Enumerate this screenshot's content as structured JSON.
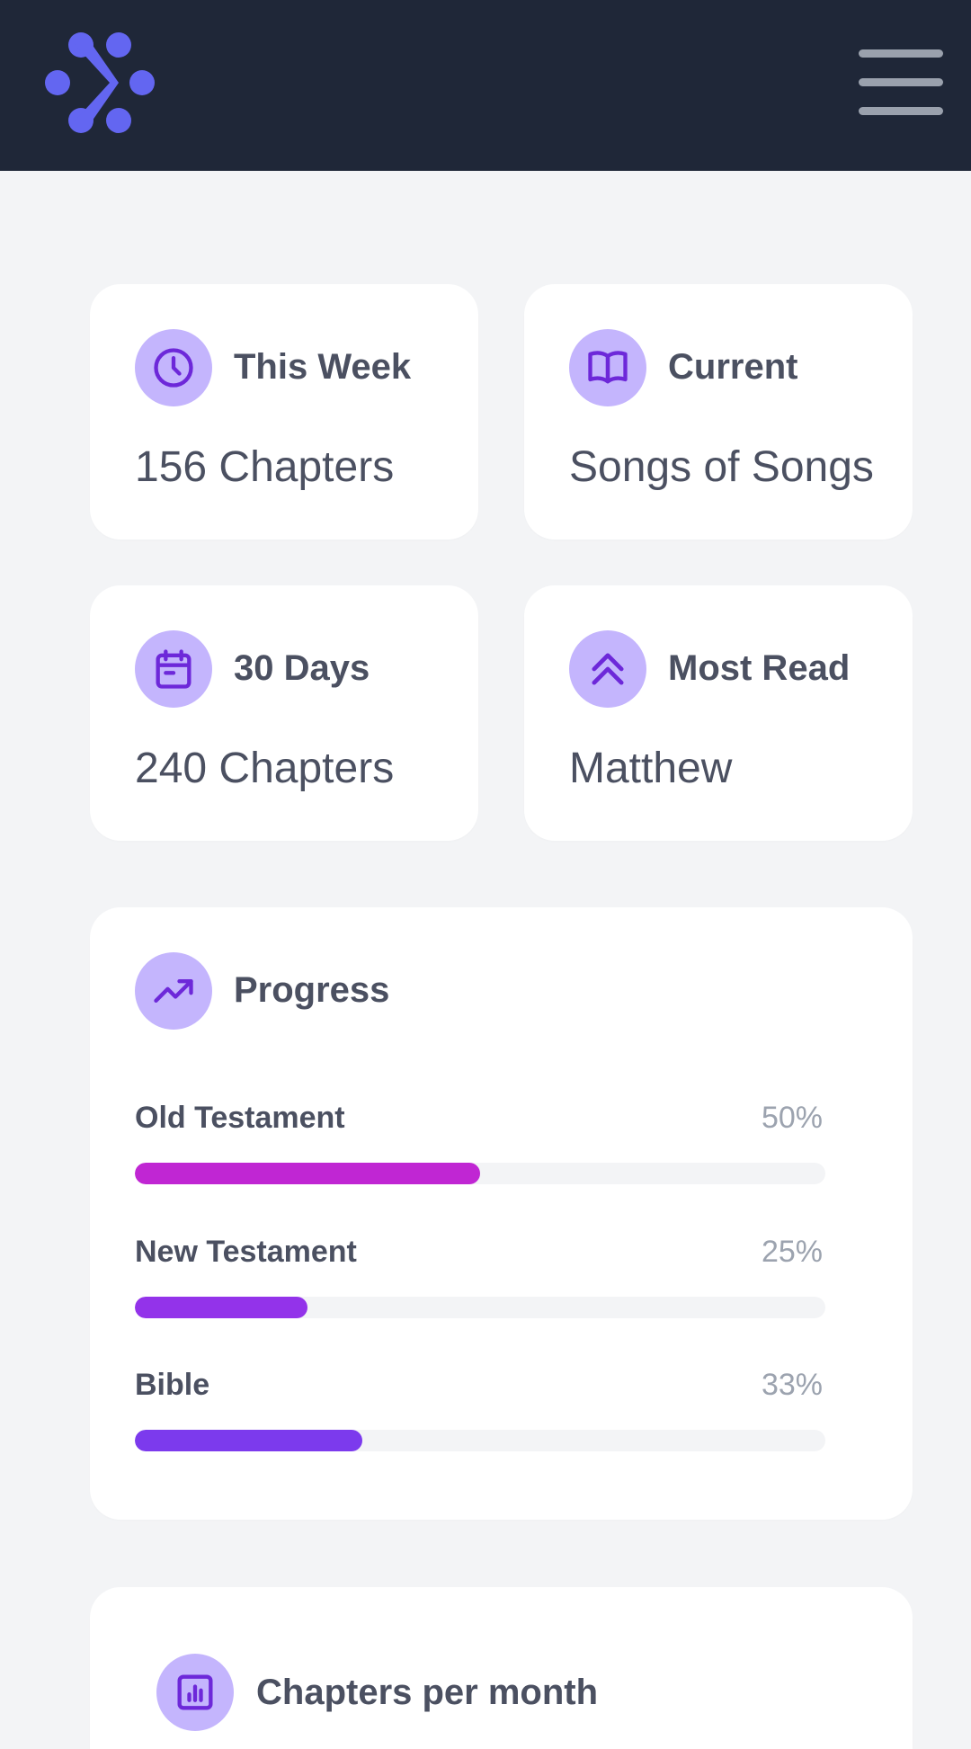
{
  "header": {
    "logo": "app-logo",
    "menu_icon": "hamburger-menu-icon"
  },
  "stats": [
    {
      "title": "This Week",
      "value": "156 Chapters",
      "icon": "clock-icon"
    },
    {
      "title": "Current",
      "value": "Songs of Songs",
      "icon": "book-open-icon"
    },
    {
      "title": "30 Days",
      "value": "240 Chapters",
      "icon": "calendar-icon"
    },
    {
      "title": "Most Read",
      "value": "Matthew",
      "icon": "chevrons-up-icon"
    }
  ],
  "progress": {
    "title": "Progress",
    "icon": "trending-up-icon",
    "items": [
      {
        "label": "Old Testament",
        "percent_label": "50%",
        "percent": 50,
        "color": "#c026d3"
      },
      {
        "label": "New Testament",
        "percent_label": "25%",
        "percent": 25,
        "color": "#9333ea"
      },
      {
        "label": "Bible",
        "percent_label": "33%",
        "percent": 33,
        "color": "#7c3aed"
      }
    ]
  },
  "chapters_per_month": {
    "title": "Chapters per month",
    "icon": "bar-chart-icon"
  },
  "colors": {
    "header_bg": "#1f2738",
    "page_bg": "#f3f4f6",
    "logo": "#6366f1",
    "icon_bg": "#c4b5fd",
    "icon_stroke": "#6d28d9"
  }
}
